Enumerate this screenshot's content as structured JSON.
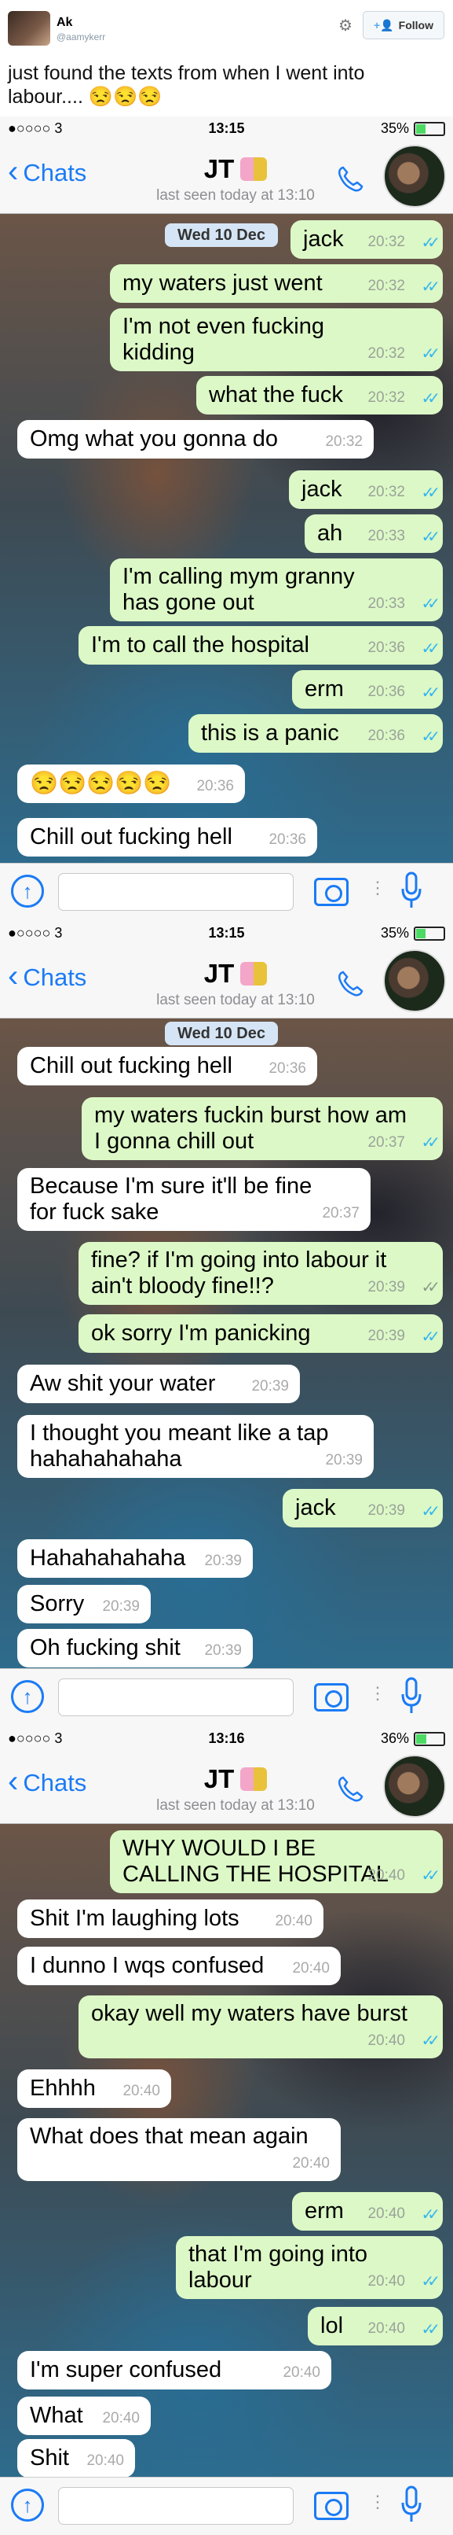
{
  "tweet": {
    "name": "Ak",
    "handle": "@aamykerr",
    "follow_label": "Follow",
    "text": "just found the texts from when I went into labour.... 😒😒😒"
  },
  "screens": [
    {
      "status": {
        "carrier": "●○○○○ 3",
        "time": "13:15",
        "battery": "35%",
        "battery_level": 0.35
      },
      "nav": {
        "back_label": "Chats",
        "contact_name": "JT",
        "last_seen": "last seen today at 13:10"
      },
      "date_pill": "Wed 10 Dec",
      "messages": [
        {
          "text": "jack",
          "time": "20:32",
          "dir": "out"
        },
        {
          "text": "my waters just went",
          "time": "20:32",
          "dir": "out"
        },
        {
          "text": "I'm not even fucking kidding",
          "time": "20:32",
          "dir": "out"
        },
        {
          "text": "what the fuck",
          "time": "20:32",
          "dir": "out"
        },
        {
          "text": "Omg what you gonna do",
          "time": "20:32",
          "dir": "in"
        },
        {
          "text": "jack",
          "time": "20:32",
          "dir": "out"
        },
        {
          "text": "ah",
          "time": "20:33",
          "dir": "out"
        },
        {
          "text": "I'm calling mym granny has gone out",
          "time": "20:33",
          "dir": "out"
        },
        {
          "text": "I'm to call the hospital",
          "time": "20:36",
          "dir": "out"
        },
        {
          "text": "erm",
          "time": "20:36",
          "dir": "out"
        },
        {
          "text": "this is a panic",
          "time": "20:36",
          "dir": "out"
        },
        {
          "text": "😒😒😒😒😒",
          "time": "20:36",
          "dir": "in"
        },
        {
          "text": "Chill out fucking hell",
          "time": "20:36",
          "dir": "in"
        }
      ]
    },
    {
      "status": {
        "carrier": "●○○○○ 3",
        "time": "13:15",
        "battery": "35%",
        "battery_level": 0.35
      },
      "nav": {
        "back_label": "Chats",
        "contact_name": "JT",
        "last_seen": "last seen today at 13:10"
      },
      "date_pill": "Wed 10 Dec",
      "messages": [
        {
          "text": "Chill out fucking hell",
          "time": "20:36",
          "dir": "in"
        },
        {
          "text": "my waters fuckin burst how am I gonna chill out",
          "time": "20:37",
          "dir": "out"
        },
        {
          "text": "Because I'm sure it'll be fine for fuck sake",
          "time": "20:37",
          "dir": "in"
        },
        {
          "text": "fine? if I'm going into labour it ain't bloody fine!!?",
          "time": "20:39",
          "dir": "out"
        },
        {
          "text": "ok sorry I'm panicking",
          "time": "20:39",
          "dir": "out"
        },
        {
          "text": "Aw shit your water",
          "time": "20:39",
          "dir": "in"
        },
        {
          "text": "I thought you meant like a tap hahahahahaha",
          "time": "20:39",
          "dir": "in"
        },
        {
          "text": "jack",
          "time": "20:39",
          "dir": "out"
        },
        {
          "text": "Hahahahahaha",
          "time": "20:39",
          "dir": "in"
        },
        {
          "text": "Sorry",
          "time": "20:39",
          "dir": "in"
        },
        {
          "text": "Oh fucking shit",
          "time": "20:39",
          "dir": "in"
        }
      ]
    },
    {
      "status": {
        "carrier": "●○○○○ 3",
        "time": "13:16",
        "battery": "36%",
        "battery_level": 0.36
      },
      "nav": {
        "back_label": "Chats",
        "contact_name": "JT",
        "last_seen": "last seen today at 13:10"
      },
      "messages": [
        {
          "text": "WHY WOULD I BE CALLING THE HOSPITAL",
          "time": "20:40",
          "dir": "out"
        },
        {
          "text": "Shit I'm laughing lots",
          "time": "20:40",
          "dir": "in"
        },
        {
          "text": "I dunno I wqs confused",
          "time": "20:40",
          "dir": "in"
        },
        {
          "text": "okay well my waters have burst",
          "time": "20:40",
          "dir": "out"
        },
        {
          "text": "Ehhhh",
          "time": "20:40",
          "dir": "in"
        },
        {
          "text": "What does that mean again",
          "time": "20:40",
          "dir": "in"
        },
        {
          "text": "erm",
          "time": "20:40",
          "dir": "out"
        },
        {
          "text": "that I'm going into labour",
          "time": "20:40",
          "dir": "out"
        },
        {
          "text": "lol",
          "time": "20:40",
          "dir": "out"
        },
        {
          "text": "I'm super confused",
          "time": "20:40",
          "dir": "in"
        },
        {
          "text": "What",
          "time": "20:40",
          "dir": "in"
        },
        {
          "text": "Shit",
          "time": "20:40",
          "dir": "in"
        }
      ]
    }
  ],
  "colors": {
    "accent": "#1b7bf5",
    "out_bubble": "#dcf8c6",
    "in_bubble": "#ffffff",
    "read_ticks": "#34b7f1"
  },
  "icons": [
    "gear-icon",
    "person-add-icon",
    "chevron-left-icon",
    "phone-icon",
    "upload-icon",
    "camera-icon",
    "microphone-icon",
    "read-receipt-icon"
  ]
}
